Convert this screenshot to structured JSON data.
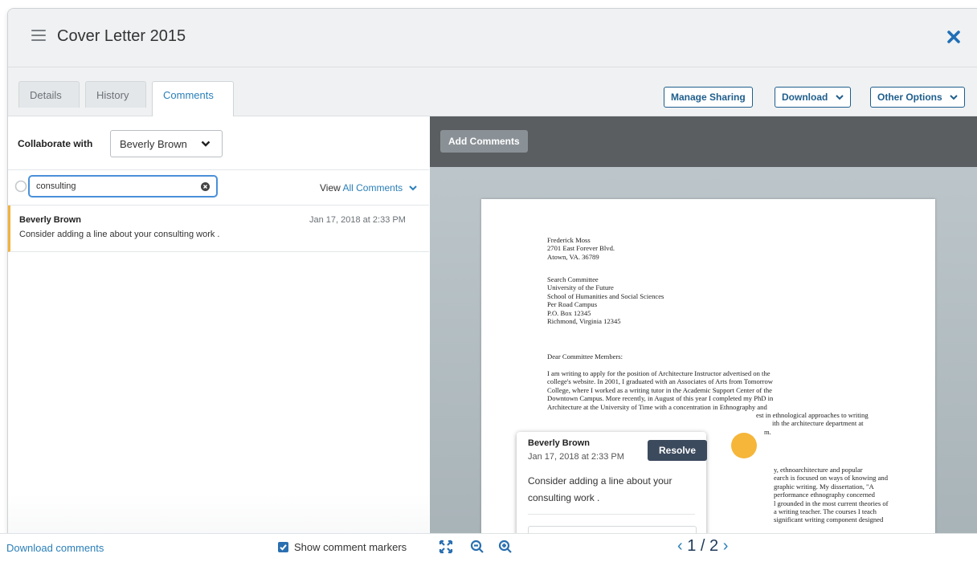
{
  "header": {
    "title": "Cover Letter 2015"
  },
  "tabs": [
    {
      "label": "Details"
    },
    {
      "label": "History"
    },
    {
      "label": "Comments"
    }
  ],
  "actions": {
    "manage_sharing": "Manage Sharing",
    "download": "Download",
    "other_options": "Other Options"
  },
  "collaborate": {
    "label": "Collaborate with",
    "selected": "Beverly Brown"
  },
  "search": {
    "value": "consulting"
  },
  "view_all": {
    "prefix": "View",
    "link": "All Comments"
  },
  "comments": [
    {
      "author": "Beverly Brown",
      "date": "Jan 17, 2018 at 2:33 PM",
      "text": "Consider adding a line about your consulting work ."
    }
  ],
  "viewer": {
    "add_comments": "Add Comments",
    "document": {
      "sender": [
        "Frederick Moss",
        "2701 East Forever Blvd.",
        "Atown, VA. 36789"
      ],
      "recipient": [
        "Search Committee",
        "University of the Future",
        "School of Humanities and Social Sciences",
        "Per Road Campus",
        "P.O. Box 12345",
        "Richmond, Virginia 12345"
      ],
      "salutation": "Dear Committee Members:",
      "para1": [
        "I am writing to apply for the position of Architecture Instructor advertised on the",
        "college's website. In 2001, I graduated with an Associates of Arts from Tomorrow",
        "College, where I worked as a writing tutor in the Academic Support Center of the",
        "Downtown Campus. More recently, in August of this year I completed my PhD in",
        "Architecture at the University of Time with a concentration in Ethnography and",
        "est in ethnological approaches to writing",
        "ith the architecture department at",
        "m."
      ],
      "para2": [
        "y, ethnoarchitecture and popular",
        "earch is focused on ways of knowing and",
        "graphic writing. My dissertation, \"A",
        "performance ethnography concerned",
        "l grounded in the most current theories of",
        "a writing teacher. The courses I teach",
        "significant writing component designed"
      ]
    },
    "popup": {
      "author": "Beverly Brown",
      "date": "Jan 17, 2018 at 2:33 PM",
      "resolve": "Resolve",
      "text": "Consider adding a line about your consulting work ."
    }
  },
  "footer": {
    "download_comments": "Download comments",
    "show_markers": "Show comment markers",
    "show_markers_checked": true,
    "page_current": "1",
    "page_total": "2"
  },
  "colors": {
    "accent": "#2a7fb8",
    "button_border": "#1f5e8c",
    "marker": "#f5b63a",
    "resolve_bg": "#3c4a5e"
  }
}
